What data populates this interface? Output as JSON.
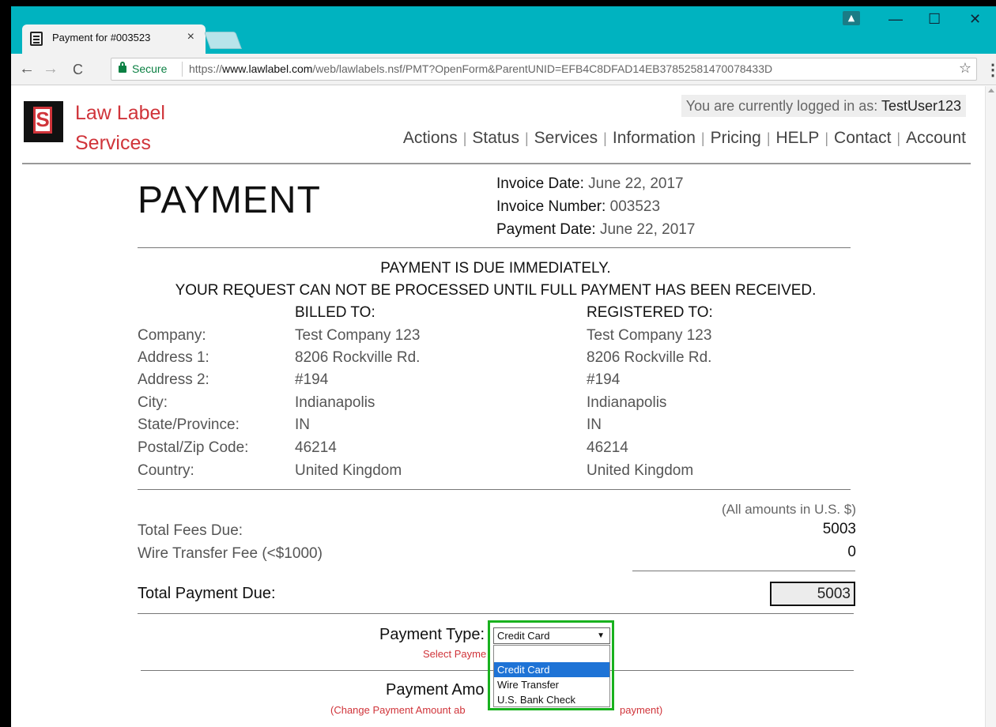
{
  "browser": {
    "tab_title": "Payment for #003523",
    "tab_close": "×",
    "secure_label": "Secure",
    "url_scheme": "https://",
    "url_host": "www.lawlabel.com",
    "url_path": "/web/lawlabels.nsf/PMT?OpenForm&ParentUNID=EFB4C8DFAD14EB37852581470078433D",
    "back": "←",
    "forward": "→",
    "reload": "C",
    "star": "☆",
    "menu": "⋮",
    "minimize": "—",
    "maximize": "☐",
    "close": "✕"
  },
  "site": {
    "logo_letter": "S",
    "brand_line1": "Law Label",
    "brand_line2": "Services",
    "login_prefix": "You are currently logged in as: ",
    "login_user": "TestUser123",
    "nav": [
      "Actions",
      "Status",
      "Services",
      "Information",
      "Pricing",
      "HELP",
      "Contact",
      "Account"
    ],
    "nav_sep": "|"
  },
  "payment": {
    "title": "PAYMENT",
    "invoice_date_label": "Invoice Date: ",
    "invoice_date": "June 22, 2017",
    "invoice_number_label": "Invoice Number: ",
    "invoice_number": "003523",
    "payment_date_label": "Payment Date: ",
    "payment_date": "June 22, 2017",
    "notice1": "PAYMENT IS DUE IMMEDIATELY.",
    "notice2": "YOUR REQUEST CAN NOT BE PROCESSED UNTIL FULL PAYMENT HAS BEEN RECEIVED.",
    "billed_to_head": "BILLED TO:",
    "registered_to_head": "REGISTERED TO:",
    "rows": [
      {
        "label": "Company:",
        "billed": "Test Company 123",
        "registered": "Test Company 123"
      },
      {
        "label": "Address 1:",
        "billed": "8206 Rockville Rd.",
        "registered": "8206 Rockville Rd."
      },
      {
        "label": "Address 2:",
        "billed": "#194",
        "registered": "#194"
      },
      {
        "label": "City:",
        "billed": "Indianapolis",
        "registered": "Indianapolis"
      },
      {
        "label": "State/Province:",
        "billed": "IN",
        "registered": "IN"
      },
      {
        "label": "Postal/Zip Code:",
        "billed": "46214",
        "registered": "46214"
      },
      {
        "label": "Country:",
        "billed": "United Kingdom",
        "registered": "United Kingdom"
      }
    ],
    "amounts_note": "(All amounts in U.S. $)",
    "total_fees_label": "Total Fees Due:",
    "total_fees": "5003",
    "wire_fee_label": "Wire Transfer Fee (<$1000)",
    "wire_fee": "0",
    "total_due_label": "Total Payment Due:",
    "total_due": "5003",
    "payment_type_label": "Payment Type:",
    "payment_type_selected": "Credit Card",
    "payment_type_hint": "Select Payme",
    "payment_type_options": [
      "",
      "Credit Card",
      "Wire Transfer",
      "U.S. Bank Check"
    ],
    "payment_amount_label": "Payment Amo",
    "payment_amount_hint_left": "(Change Payment Amount ab",
    "payment_amount_hint_right": "payment)"
  },
  "colors": {
    "titlebar": "#00b3c0",
    "brand_red": "#d0343a",
    "highlight_green": "#19b11e",
    "selected_option": "#1e73d6"
  }
}
